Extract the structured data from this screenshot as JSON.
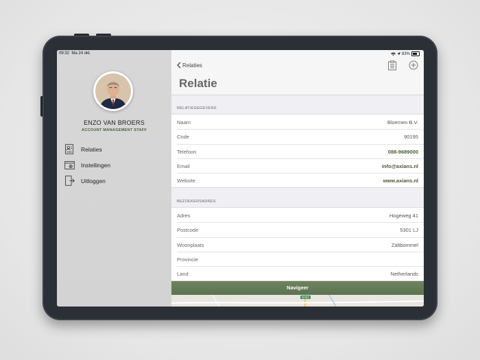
{
  "status": {
    "time": "09:32",
    "date": "Ma 24 okt.",
    "battery": "83%"
  },
  "profile": {
    "name": "ENZO VAN BROERS",
    "role": "ACCOUNT MANAGEMENT STAFF"
  },
  "menu": [
    {
      "label": "Relaties",
      "icon": "contacts-icon"
    },
    {
      "label": "Instellingen",
      "icon": "settings-icon"
    },
    {
      "label": "Uitloggen",
      "icon": "logout-icon"
    }
  ],
  "nav": {
    "back_label": "Relaties",
    "title": "Relatie"
  },
  "sections": {
    "relatie": {
      "header": "RELATIEGEGEVENS",
      "rows": [
        {
          "key": "Naam",
          "value": "Bloemen B.V."
        },
        {
          "key": "Code",
          "value": "90195"
        },
        {
          "key": "Telefoon",
          "value": "088-9689000"
        },
        {
          "key": "Email",
          "value": "info@axians.nl"
        },
        {
          "key": "Website",
          "value": "www.axians.nl"
        }
      ]
    },
    "bezoek": {
      "header": "BEZOEKERSADRES",
      "rows": [
        {
          "key": "Adres",
          "value": "Hogeweg 41"
        },
        {
          "key": "Postcode",
          "value": "5301 LJ"
        },
        {
          "key": "Woonplaats",
          "value": "Zaltbommel"
        },
        {
          "key": "Provincie",
          "value": ""
        },
        {
          "key": "Land",
          "value": "Netherlands"
        }
      ]
    }
  },
  "navigate_label": "Navigeer",
  "map": {
    "road_badge": "N322"
  },
  "colors": {
    "accent": "#4a5a34",
    "navigate_bar": "#64795a",
    "device": "#2b2f36"
  }
}
